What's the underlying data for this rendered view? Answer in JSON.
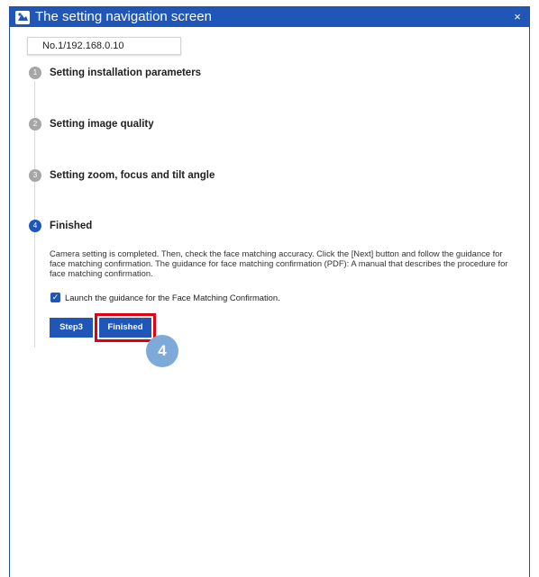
{
  "window": {
    "title": "The setting navigation screen",
    "close_glyph": "×",
    "colors": {
      "title_bar": "#1f56b8",
      "accent": "#1f56b8",
      "inactive_step": "#a6a6a6",
      "highlight": "#e00012",
      "callout": "#7daad8"
    }
  },
  "address": "No.1/192.168.0.10",
  "steps": [
    {
      "number": "1",
      "label": "Setting installation parameters"
    },
    {
      "number": "2",
      "label": "Setting image quality"
    },
    {
      "number": "3",
      "label": "Setting zoom, focus and tilt angle"
    },
    {
      "number": "4",
      "label": "Finished"
    }
  ],
  "finished": {
    "description": "Camera setting is completed. Then, check the face matching accuracy. Click the [Next] button and follow the guidance for face matching confirmation. The guidance for face matching confirmation (PDF): A manual that describes the procedure for face matching confirmation.",
    "checkbox_label": "Launch the guidance for the Face Matching Confirmation.",
    "checkbox_checked": true
  },
  "buttons": {
    "step3": "Step3",
    "finished": "Finished"
  },
  "callout": "4",
  "icons": {
    "app": "app-icon",
    "close": "close-icon",
    "checkbox": "checkbox-checked-icon"
  }
}
